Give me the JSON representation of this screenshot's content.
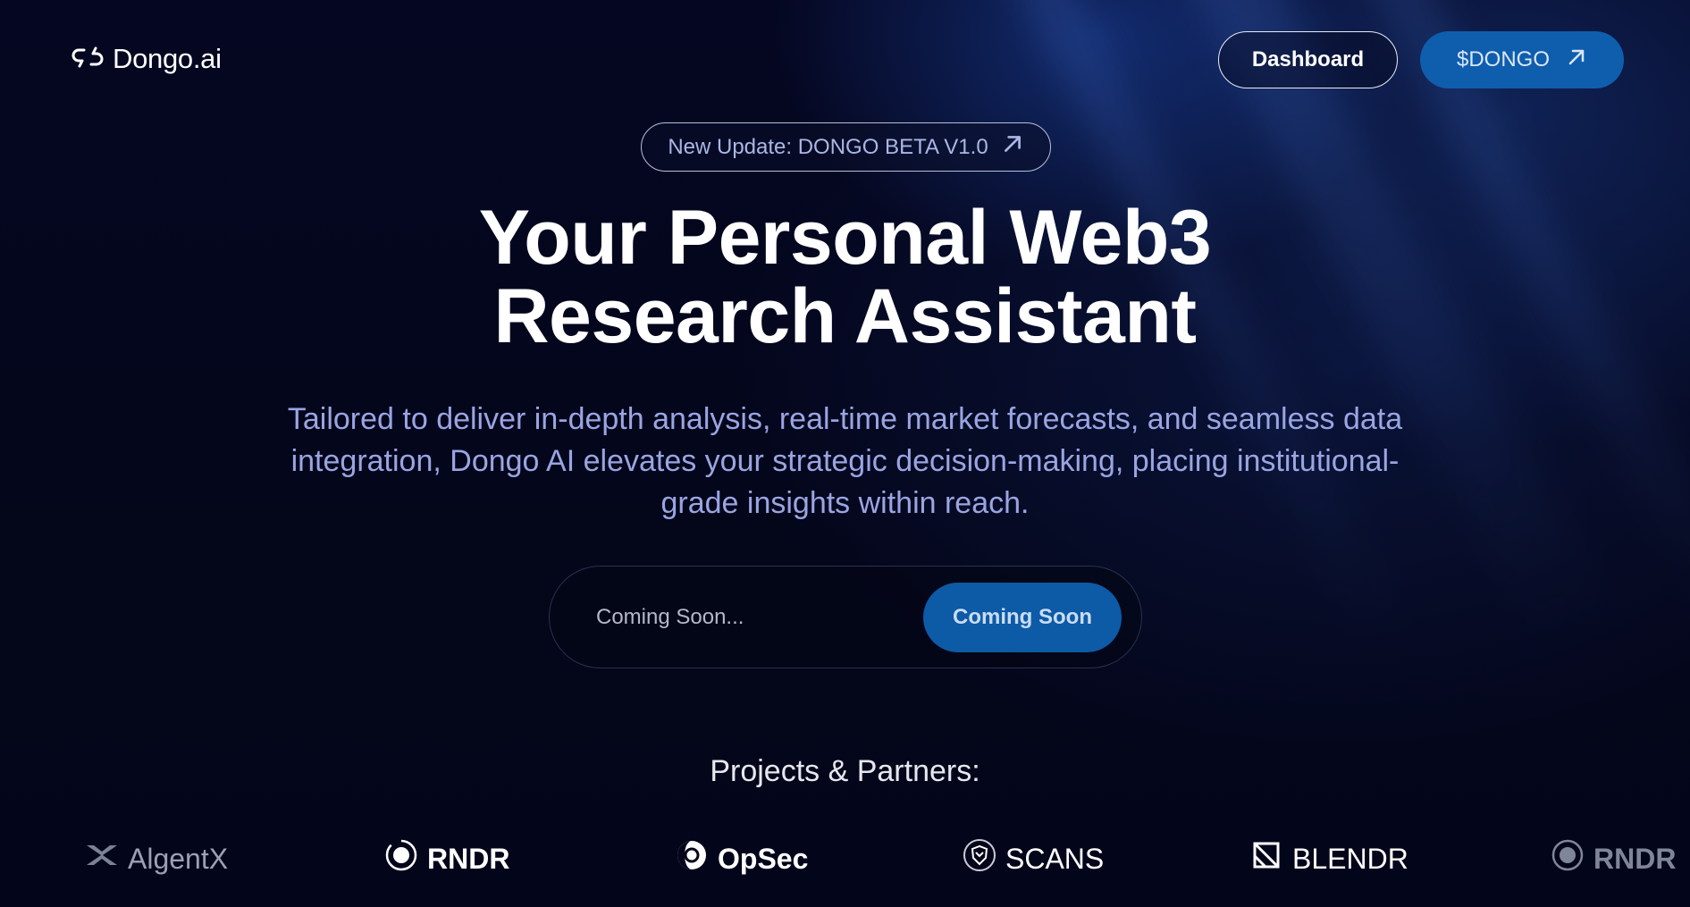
{
  "header": {
    "brand": "Dongo.ai",
    "dashboard_label": "Dashboard",
    "token_label": "$DONGO"
  },
  "hero": {
    "update_label": "New Update: DONGO BETA V1.0",
    "headline_line1": "Your Personal Web3",
    "headline_line2": "Research Assistant",
    "description": "Tailored to deliver in-depth analysis, real-time market forecasts, and seamless data integration, Dongo AI elevates your strategic decision-making, placing institutional-grade insights within reach."
  },
  "cta": {
    "input_placeholder": "Coming Soon...",
    "button_label": "Coming Soon"
  },
  "partners": {
    "title": "Projects & Partners:",
    "items": [
      {
        "label": "AlgentX",
        "icon": "algentx-icon"
      },
      {
        "label": "RNDR",
        "icon": "rndr-icon"
      },
      {
        "label": "OpSec",
        "icon": "opsec-icon"
      },
      {
        "label": "SCANS",
        "icon": "scans-icon"
      },
      {
        "label": "BLENDR",
        "icon": "blendr-icon"
      },
      {
        "label": "RNDR",
        "icon": "rndr-icon"
      }
    ]
  },
  "colors": {
    "background": "#04061a",
    "accent": "#0f5eae",
    "subtext": "#9aa5e2"
  }
}
